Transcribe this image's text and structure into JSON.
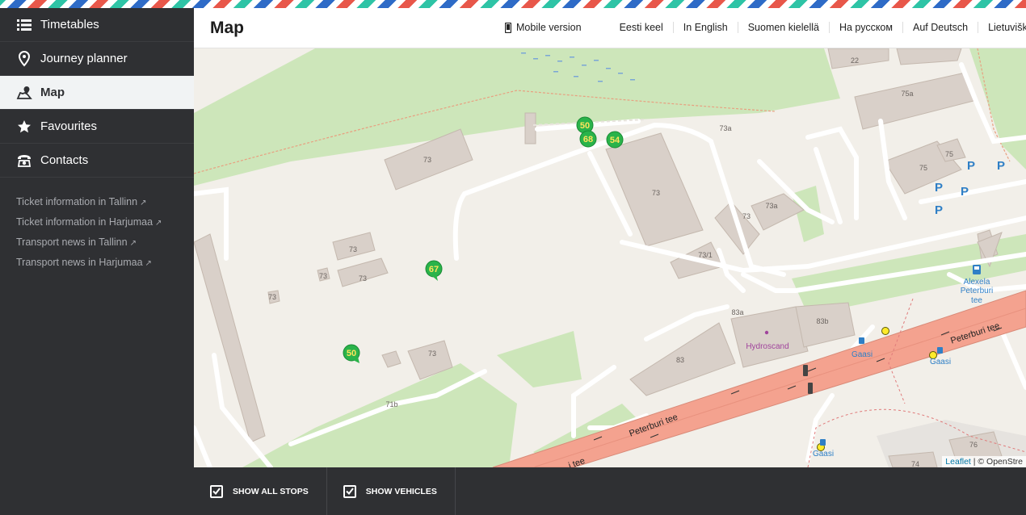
{
  "nav": [
    {
      "label": "Timetables",
      "icon": "list-icon",
      "active": false
    },
    {
      "label": "Journey planner",
      "icon": "map-pin-icon",
      "active": false
    },
    {
      "label": "Map",
      "icon": "map-icon",
      "active": true
    },
    {
      "label": "Favourites",
      "icon": "star-icon",
      "active": false
    },
    {
      "label": "Contacts",
      "icon": "phone-icon",
      "active": false
    }
  ],
  "side_links": [
    "Ticket information in Tallinn",
    "Ticket information in Harjumaa",
    "Transport news in Tallinn",
    "Transport news in Harjumaa"
  ],
  "header": {
    "title": "Map",
    "mobile_version": "Mobile version",
    "languages": [
      "Eesti keel",
      "In English",
      "Suomen kielellä",
      "На русском",
      "Auf Deutsch",
      "Lietuviška"
    ]
  },
  "map": {
    "vehicles": [
      "50",
      "68",
      "54",
      "67",
      "50"
    ],
    "labels": {
      "b73a": "73",
      "b73b": "73",
      "b73c": "73",
      "b73d": "73",
      "b73e": "73",
      "b73f": "73",
      "b73g": "73",
      "b73h": "73",
      "b73a_n": "73a",
      "b73a_n2": "73a",
      "b73_1": "73/1",
      "b83": "83",
      "b83a": "83a",
      "b83b": "83b",
      "b22": "22",
      "b75a": "75a",
      "b75": "75",
      "b75b": "75",
      "b76": "76",
      "b74": "74",
      "b71b": "71b",
      "hydroscand": "Hydroscand",
      "alexela": [
        "Alexela",
        "Peterburi",
        "tee"
      ],
      "road1": "Peterburi tee",
      "road2": "Peterburi tee",
      "road3": "i tee",
      "stop1": "Gaasi",
      "stop2": "Gaasi",
      "stop3": "Gaasi",
      "parking": "P"
    },
    "attribution_leaflet": "Leaflet",
    "attribution_rest": " | © OpenStre"
  },
  "bottom": {
    "show_all_stops": "Show all stops",
    "show_vehicles": "Show vehicles"
  },
  "colors": {
    "sidebar_bg": "#2f3033",
    "road_main": "#f4a28f",
    "grass": "#cde6ba",
    "building": "#d9d0c9",
    "vehicle_marker": "#2ab34a",
    "vehicle_text": "#ffe45c"
  }
}
